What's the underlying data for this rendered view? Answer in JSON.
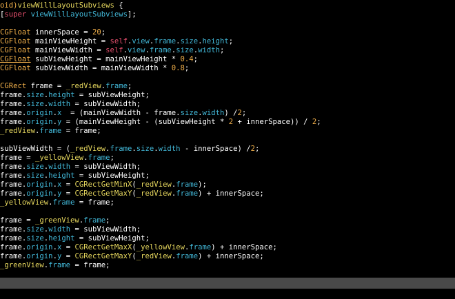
{
  "theme": {
    "background": "#000000",
    "scrollbar": "#494949",
    "plain": "#ffffff",
    "type": "#f2b04a",
    "keyword": "#e8506e",
    "property": "#42b8d8",
    "variable": "#e6d75e",
    "number": "#f2b04a"
  },
  "code_lines": [
    [
      [
        "t-type",
        "oid)"
      ],
      [
        "t-var",
        "viewWillLayoutSubviews"
      ],
      [
        "t-plain",
        " {"
      ]
    ],
    [
      [
        "t-plain",
        "["
      ],
      [
        "t-kw",
        "super"
      ],
      [
        "t-plain",
        " "
      ],
      [
        "t-prop",
        "viewWillLayoutSubviews"
      ],
      [
        "t-plain",
        "];"
      ]
    ],
    [],
    [
      [
        "t-type",
        "CGFloat"
      ],
      [
        "t-plain",
        " innerSpace = "
      ],
      [
        "t-num",
        "20"
      ],
      [
        "t-plain",
        ";"
      ]
    ],
    [
      [
        "t-type",
        "CGFloat"
      ],
      [
        "t-plain",
        " mainViewHeight = "
      ],
      [
        "t-kw",
        "self"
      ],
      [
        "t-plain",
        "."
      ],
      [
        "t-prop",
        "view"
      ],
      [
        "t-plain",
        "."
      ],
      [
        "t-prop",
        "frame"
      ],
      [
        "t-plain",
        "."
      ],
      [
        "t-prop",
        "size"
      ],
      [
        "t-plain",
        "."
      ],
      [
        "t-prop",
        "height"
      ],
      [
        "t-plain",
        ";"
      ]
    ],
    [
      [
        "t-type",
        "CGFloat"
      ],
      [
        "t-plain",
        " mainViewWidth = "
      ],
      [
        "t-kw",
        "self"
      ],
      [
        "t-plain",
        "."
      ],
      [
        "t-prop",
        "view"
      ],
      [
        "t-plain",
        "."
      ],
      [
        "t-prop",
        "frame"
      ],
      [
        "t-plain",
        "."
      ],
      [
        "t-prop",
        "size"
      ],
      [
        "t-plain",
        "."
      ],
      [
        "t-prop",
        "width"
      ],
      [
        "t-plain",
        ";"
      ]
    ],
    [
      [
        "t-type t-underline",
        "CGFloat"
      ],
      [
        "t-plain",
        " subViewHeight = mainViewHeight * "
      ],
      [
        "t-num",
        "0.4"
      ],
      [
        "t-plain",
        ";"
      ]
    ],
    [
      [
        "t-type",
        "CGFloat"
      ],
      [
        "t-plain",
        " subViewWidth = mainViewWidth * "
      ],
      [
        "t-num",
        "0.8"
      ],
      [
        "t-plain",
        ";"
      ]
    ],
    [],
    [
      [
        "t-type",
        "CGRect"
      ],
      [
        "t-plain",
        " frame = "
      ],
      [
        "t-ivar",
        "_redView"
      ],
      [
        "t-plain",
        "."
      ],
      [
        "t-prop",
        "frame"
      ],
      [
        "t-plain",
        ";"
      ]
    ],
    [
      [
        "t-plain",
        "frame."
      ],
      [
        "t-prop",
        "size"
      ],
      [
        "t-plain",
        "."
      ],
      [
        "t-prop",
        "height"
      ],
      [
        "t-plain",
        " = subViewHeight;"
      ]
    ],
    [
      [
        "t-plain",
        "frame."
      ],
      [
        "t-prop",
        "size"
      ],
      [
        "t-plain",
        "."
      ],
      [
        "t-prop",
        "width"
      ],
      [
        "t-plain",
        " = subViewWidth;"
      ]
    ],
    [
      [
        "t-plain",
        "frame."
      ],
      [
        "t-prop",
        "origin"
      ],
      [
        "t-plain",
        "."
      ],
      [
        "t-prop",
        "x"
      ],
      [
        "t-plain",
        "  = (mainViewWidth - frame."
      ],
      [
        "t-prop",
        "size"
      ],
      [
        "t-plain",
        "."
      ],
      [
        "t-prop",
        "width"
      ],
      [
        "t-plain",
        ") /"
      ],
      [
        "t-num",
        "2"
      ],
      [
        "t-plain",
        ";"
      ]
    ],
    [
      [
        "t-plain",
        "frame."
      ],
      [
        "t-prop",
        "origin"
      ],
      [
        "t-plain",
        "."
      ],
      [
        "t-prop",
        "y"
      ],
      [
        "t-plain",
        " = (mainViewHeight - (subViewHeight * "
      ],
      [
        "t-num",
        "2"
      ],
      [
        "t-plain",
        " + innerSpace)) / "
      ],
      [
        "t-num",
        "2"
      ],
      [
        "t-plain",
        ";"
      ]
    ],
    [
      [
        "t-ivar",
        "_redView"
      ],
      [
        "t-plain",
        "."
      ],
      [
        "t-prop",
        "frame"
      ],
      [
        "t-plain",
        " = frame;"
      ]
    ],
    [],
    [
      [
        "t-plain",
        "subViewWidth = ("
      ],
      [
        "t-ivar",
        "_redView"
      ],
      [
        "t-plain",
        "."
      ],
      [
        "t-prop",
        "frame"
      ],
      [
        "t-plain",
        "."
      ],
      [
        "t-prop",
        "size"
      ],
      [
        "t-plain",
        "."
      ],
      [
        "t-prop",
        "width"
      ],
      [
        "t-plain",
        " - innerSpace) /"
      ],
      [
        "t-num",
        "2"
      ],
      [
        "t-plain",
        ";"
      ]
    ],
    [
      [
        "t-plain",
        "frame = "
      ],
      [
        "t-ivar",
        "_yellowView"
      ],
      [
        "t-plain",
        "."
      ],
      [
        "t-prop",
        "frame"
      ],
      [
        "t-plain",
        ";"
      ]
    ],
    [
      [
        "t-plain",
        "frame."
      ],
      [
        "t-prop",
        "size"
      ],
      [
        "t-plain",
        "."
      ],
      [
        "t-prop",
        "width"
      ],
      [
        "t-plain",
        " = subViewWidth;"
      ]
    ],
    [
      [
        "t-plain",
        "frame."
      ],
      [
        "t-prop",
        "size"
      ],
      [
        "t-plain",
        "."
      ],
      [
        "t-prop",
        "height"
      ],
      [
        "t-plain",
        " = subViewHeight;"
      ]
    ],
    [
      [
        "t-plain",
        "frame."
      ],
      [
        "t-prop",
        "origin"
      ],
      [
        "t-plain",
        "."
      ],
      [
        "t-prop",
        "x"
      ],
      [
        "t-plain",
        " = "
      ],
      [
        "t-func",
        "CGRectGetMinX"
      ],
      [
        "t-plain",
        "("
      ],
      [
        "t-ivar",
        "_redView"
      ],
      [
        "t-plain",
        "."
      ],
      [
        "t-prop",
        "frame"
      ],
      [
        "t-plain",
        ");"
      ]
    ],
    [
      [
        "t-plain",
        "frame."
      ],
      [
        "t-prop",
        "origin"
      ],
      [
        "t-plain",
        "."
      ],
      [
        "t-prop",
        "y"
      ],
      [
        "t-plain",
        " = "
      ],
      [
        "t-func",
        "CGRectGetMaxY"
      ],
      [
        "t-plain",
        "("
      ],
      [
        "t-ivar",
        "_redView"
      ],
      [
        "t-plain",
        "."
      ],
      [
        "t-prop",
        "frame"
      ],
      [
        "t-plain",
        ") + innerSpace;"
      ]
    ],
    [
      [
        "t-ivar",
        "_yellowView"
      ],
      [
        "t-plain",
        "."
      ],
      [
        "t-prop",
        "frame"
      ],
      [
        "t-plain",
        " = frame;"
      ]
    ],
    [],
    [
      [
        "t-plain",
        "frame = "
      ],
      [
        "t-ivar",
        "_greenView"
      ],
      [
        "t-plain",
        "."
      ],
      [
        "t-prop",
        "frame"
      ],
      [
        "t-plain",
        ";"
      ]
    ],
    [
      [
        "t-plain",
        "frame."
      ],
      [
        "t-prop",
        "size"
      ],
      [
        "t-plain",
        "."
      ],
      [
        "t-prop",
        "width"
      ],
      [
        "t-plain",
        " = subViewWidth;"
      ]
    ],
    [
      [
        "t-plain",
        "frame."
      ],
      [
        "t-prop",
        "size"
      ],
      [
        "t-plain",
        "."
      ],
      [
        "t-prop",
        "height"
      ],
      [
        "t-plain",
        " = subViewHeight;"
      ]
    ],
    [
      [
        "t-plain",
        "frame."
      ],
      [
        "t-prop",
        "origin"
      ],
      [
        "t-plain",
        "."
      ],
      [
        "t-prop",
        "x"
      ],
      [
        "t-plain",
        " = "
      ],
      [
        "t-func",
        "CGRectGetMaxX"
      ],
      [
        "t-plain",
        "("
      ],
      [
        "t-ivar",
        "_yellowView"
      ],
      [
        "t-plain",
        "."
      ],
      [
        "t-prop",
        "frame"
      ],
      [
        "t-plain",
        ") + innerSpace;"
      ]
    ],
    [
      [
        "t-plain",
        "frame."
      ],
      [
        "t-prop",
        "origin"
      ],
      [
        "t-plain",
        "."
      ],
      [
        "t-prop",
        "y"
      ],
      [
        "t-plain",
        " = "
      ],
      [
        "t-func",
        "CGRectGetMaxY"
      ],
      [
        "t-plain",
        "("
      ],
      [
        "t-ivar",
        "_redView"
      ],
      [
        "t-plain",
        "."
      ],
      [
        "t-prop",
        "frame"
      ],
      [
        "t-plain",
        ") + innerSpace;"
      ]
    ],
    [
      [
        "t-ivar",
        "_greenView"
      ],
      [
        "t-plain",
        "."
      ],
      [
        "t-prop",
        "frame"
      ],
      [
        "t-plain",
        " = frame;"
      ]
    ]
  ]
}
